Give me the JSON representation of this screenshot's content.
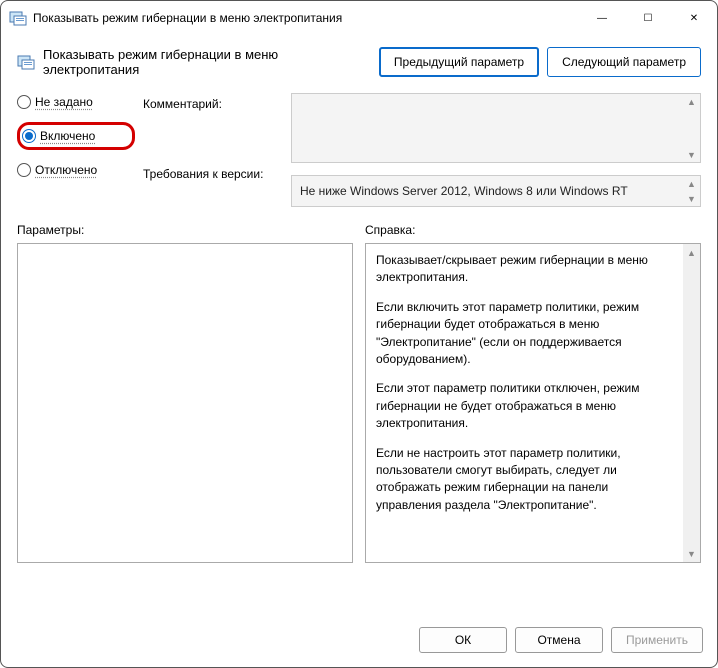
{
  "window": {
    "title": "Показывать режим гибернации в меню электропитания"
  },
  "header": {
    "title": "Показывать режим гибернации в меню электропитания",
    "prev": "Предыдущий параметр",
    "next": "Следующий параметр"
  },
  "radios": {
    "not_configured": "Не задано",
    "enabled": "Включено",
    "disabled": "Отключено",
    "selected": "enabled"
  },
  "labels": {
    "comment": "Комментарий:",
    "requirements": "Требования к версии:",
    "parameters": "Параметры:",
    "help": "Справка:"
  },
  "requirements_text": "Не ниже Windows Server 2012, Windows 8 или Windows RT",
  "help_paragraphs": {
    "p1": "Показывает/скрывает режим гибернации в меню электропитания.",
    "p2": "Если включить этот параметр политики, режим гибернации будет отображаться в меню \"Электропитание\" (если он поддерживается оборудованием).",
    "p3": "Если этот параметр политики отключен, режим гибернации не будет отображаться в меню электропитания.",
    "p4": "Если не настроить этот параметр политики, пользователи смогут выбирать, следует ли отображать режим гибернации на панели управления раздела \"Электропитание\"."
  },
  "footer": {
    "ok": "ОК",
    "cancel": "Отмена",
    "apply": "Применить"
  }
}
